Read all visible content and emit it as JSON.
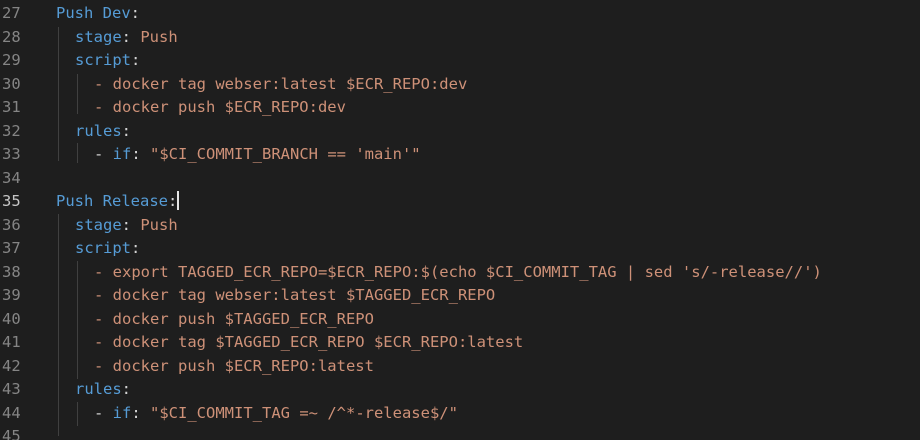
{
  "editor": {
    "active_line": 35,
    "lines": [
      {
        "num": "27",
        "key": "Push Dev",
        "colon": ":",
        "val": ""
      },
      {
        "num": "28",
        "key": "stage",
        "colon": ": ",
        "val": "Push"
      },
      {
        "num": "29",
        "key": "script",
        "colon": ":",
        "val": ""
      },
      {
        "num": "30",
        "key": "",
        "colon": "",
        "val": "- docker tag webser:latest $ECR_REPO:dev"
      },
      {
        "num": "31",
        "key": "",
        "colon": "",
        "val": "- docker push $ECR_REPO:dev"
      },
      {
        "num": "32",
        "key": "rules",
        "colon": ":",
        "val": ""
      },
      {
        "num": "33",
        "prefix": "- ",
        "key": "if",
        "colon": ": ",
        "val": "\"$CI_COMMIT_BRANCH == 'main'\""
      },
      {
        "num": "34",
        "key": "",
        "colon": "",
        "val": ""
      },
      {
        "num": "35",
        "key": "Push Release",
        "colon": ":",
        "val": ""
      },
      {
        "num": "36",
        "key": "stage",
        "colon": ": ",
        "val": "Push"
      },
      {
        "num": "37",
        "key": "script",
        "colon": ":",
        "val": ""
      },
      {
        "num": "38",
        "key": "",
        "colon": "",
        "val": "- export TAGGED_ECR_REPO=$ECR_REPO:$(echo $CI_COMMIT_TAG | sed 's/-release//')"
      },
      {
        "num": "39",
        "key": "",
        "colon": "",
        "val": "- docker tag webser:latest $TAGGED_ECR_REPO"
      },
      {
        "num": "40",
        "key": "",
        "colon": "",
        "val": "- docker push $TAGGED_ECR_REPO"
      },
      {
        "num": "41",
        "key": "",
        "colon": "",
        "val": "- docker tag $TAGGED_ECR_REPO $ECR_REPO:latest"
      },
      {
        "num": "42",
        "key": "",
        "colon": "",
        "val": "- docker push $ECR_REPO:latest"
      },
      {
        "num": "43",
        "key": "rules",
        "colon": ":",
        "val": ""
      },
      {
        "num": "44",
        "prefix": "- ",
        "key": "if",
        "colon": ": ",
        "val": "\"$CI_COMMIT_TAG =~ /^*-release$/\""
      },
      {
        "num": "45",
        "key": "",
        "colon": "",
        "val": ""
      }
    ]
  }
}
